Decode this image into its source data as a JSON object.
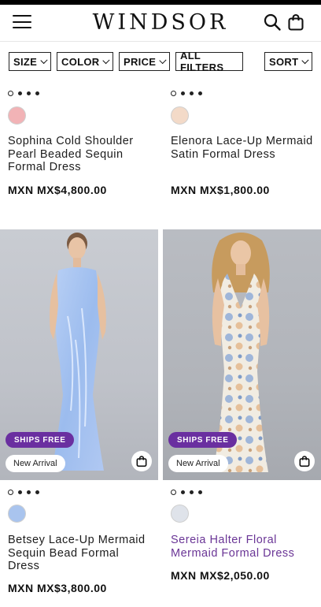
{
  "header": {
    "logo_text": "WINDSOR",
    "menu_icon": "hamburger-menu-icon",
    "search_icon": "search-icon",
    "bag_icon": "shopping-bag-icon"
  },
  "filters": {
    "size": "SIZE",
    "color": "COLOR",
    "price": "PRICE",
    "all_filters": "ALL FILTERS",
    "sort": "SORT"
  },
  "products": [
    {
      "name": "Sophina Cold Shoulder Pearl Beaded Sequin Formal Dress",
      "price": "MXN MX$4,800.00",
      "swatch_color": "#f2b3b6",
      "dots_total": 4,
      "dots_active": 0
    },
    {
      "name": "Elenora Lace-Up Mermaid Satin Formal Dress",
      "price": "MXN MX$1,800.00",
      "swatch_color": "#f3dac8",
      "dots_total": 4,
      "dots_active": 0
    },
    {
      "name": "Betsey Lace-Up Mermaid Sequin Bead Formal Dress",
      "price": "MXN MX$3,800.00",
      "swatch_color": "#a9c4ee",
      "dots_total": 4,
      "dots_active": 0,
      "badge_ships": "SHIPS FREE",
      "badge_new": "New Arrival"
    },
    {
      "name": "Sereia Halter Floral Mermaid Formal Dress",
      "price": "MXN MX$2,050.00",
      "swatch_color": "#dfe3ea",
      "dots_total": 4,
      "dots_active": 0,
      "badge_ships": "SHIPS FREE",
      "badge_new": "New Arrival"
    }
  ],
  "colors": {
    "ships_badge": "#6a2fa0",
    "visited_link": "#6a3596"
  }
}
